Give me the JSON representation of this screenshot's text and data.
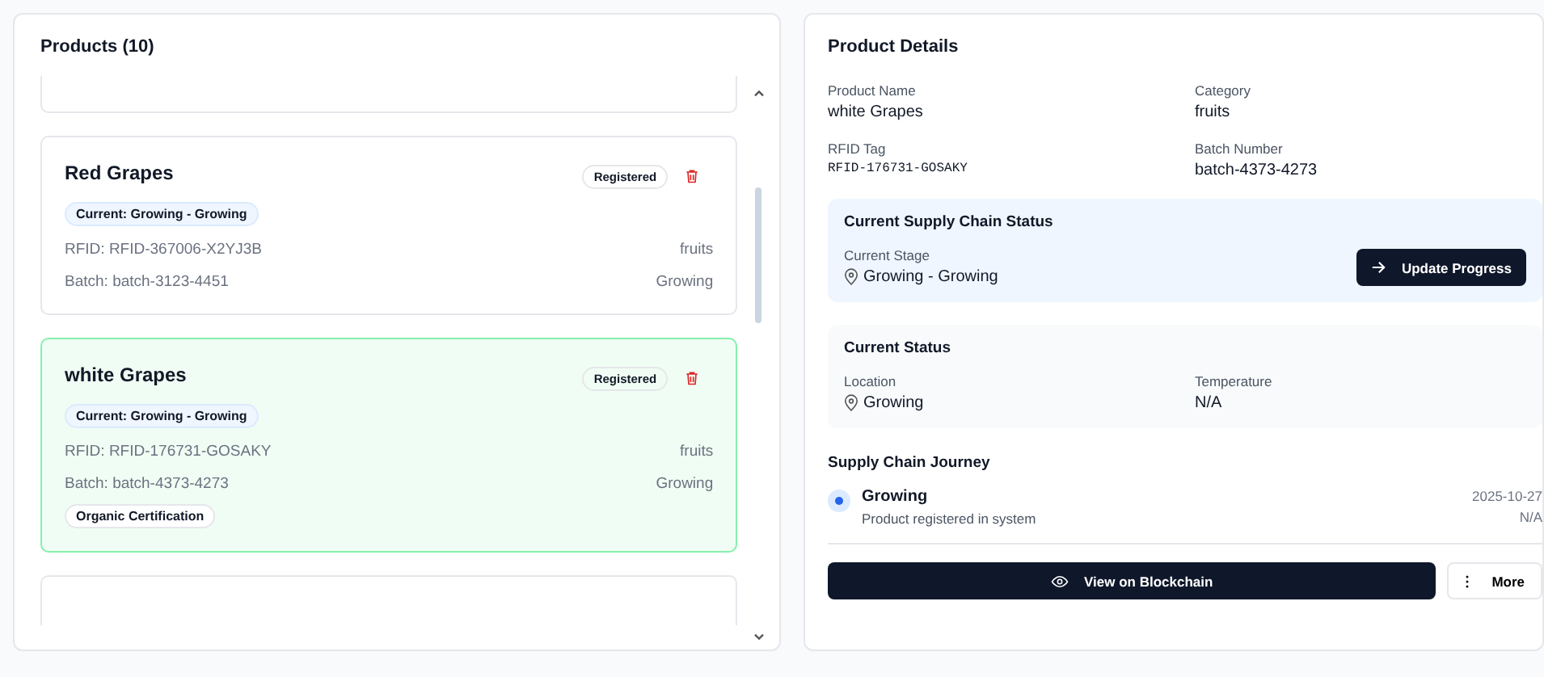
{
  "products_panel": {
    "title": "Products (10)",
    "products": [
      {
        "name": "Red Grapes",
        "badge": "Registered",
        "current": "Current: Growing - Growing",
        "rfid": "RFID: RFID-367006-X2YJ3B",
        "category": "fruits",
        "batch": "Batch: batch-3123-4451",
        "stage": "Growing",
        "selected": false
      },
      {
        "name": "white Grapes",
        "badge": "Registered",
        "current": "Current: Growing - Growing",
        "rfid": "RFID: RFID-176731-GOSAKY",
        "category": "fruits",
        "batch": "Batch: batch-4373-4273",
        "stage": "Growing",
        "tags": [
          "Organic Certification"
        ],
        "selected": true
      }
    ]
  },
  "details": {
    "title": "Product Details",
    "fields": [
      {
        "label": "Product Name",
        "value": "white Grapes",
        "kind": "text"
      },
      {
        "label": "Category",
        "value": "fruits",
        "kind": "text"
      },
      {
        "label": "RFID Tag",
        "value": "RFID-176731-GOSAKY",
        "kind": "mono"
      },
      {
        "label": "Batch Number",
        "value": "batch-4373-4273",
        "kind": "text"
      }
    ],
    "supply_status": {
      "title": "Current Supply Chain Status",
      "label": "Current Stage",
      "value": "Growing - Growing",
      "button": "Update Progress"
    },
    "current_status": {
      "title": "Current Status",
      "location_label": "Location",
      "location": "Growing",
      "temperature_label": "Temperature",
      "temperature": "N/A"
    },
    "journey": {
      "title": "Supply Chain Journey",
      "steps": [
        {
          "name": "Growing",
          "description": "Product registered in system",
          "date": "2025-10-27",
          "temperature": "N/A"
        }
      ]
    },
    "actions": {
      "primary": "View on Blockchain",
      "secondary": "More"
    }
  }
}
